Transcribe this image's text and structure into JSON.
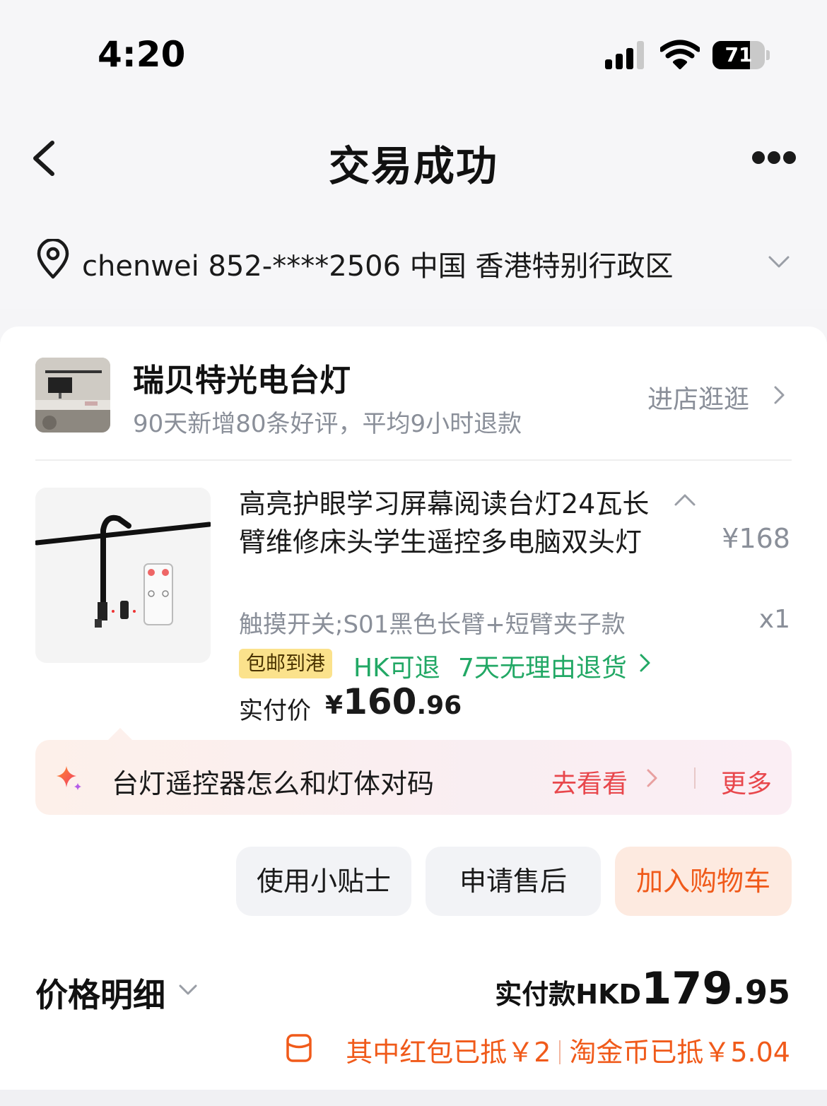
{
  "status_bar": {
    "time": "4:20",
    "battery": "71",
    "battery_fraction": 0.71
  },
  "nav": {
    "title": "交易成功"
  },
  "address": {
    "text": "chenwei  852-****2506  中国  香港特别行政区"
  },
  "shop": {
    "name": "瑞贝特光电台灯",
    "subtitle": "90天新增80条好评，平均9小时退款",
    "link": "进店逛逛"
  },
  "product": {
    "title": "高亮护眼学习屏幕阅读台灯24瓦长臂维修床头学生遥控多电脑双头灯",
    "price": "¥168",
    "spec": "触摸开关;S01黑色长臂+短臂夹子款",
    "qty": "x1",
    "tag_shipping": "包邮到港",
    "tag_hk": "HK可退",
    "tag_return": "7天无理由退货",
    "paid_label": "实付价",
    "paid_currency": "¥",
    "paid_int": "160",
    "paid_dec": ".96"
  },
  "tip": {
    "text": "台灯遥控器怎么和灯体对码",
    "go": "去看看",
    "more": "更多"
  },
  "actions": {
    "tips": "使用小贴士",
    "after_sale": "申请售后",
    "add_cart": "加入购物车"
  },
  "price_detail": {
    "label": "价格明细",
    "total_label": "实付款HKD",
    "total_int": "179",
    "total_dec": ".95",
    "discount_redpacket": "其中红包已抵￥2",
    "discount_coins": "淘金币已抵￥5.04"
  },
  "colors": {
    "accent_orange": "#f05a1a",
    "green": "#22a865",
    "red": "#e8474c"
  }
}
